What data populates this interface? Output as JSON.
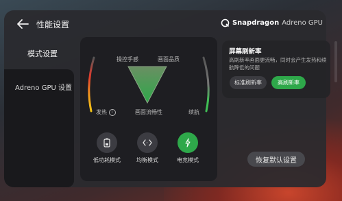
{
  "header": {
    "title": "性能设置",
    "brand_name": "Snapdragon",
    "brand_product": "Adreno GPU"
  },
  "sidebar": {
    "items": [
      {
        "label": "模式设置",
        "active": true
      },
      {
        "label": "Adreno GPU 设置",
        "active": false
      }
    ]
  },
  "performance_chart": {
    "labels": {
      "control": "操控手感",
      "quality": "画面品质",
      "heat": "发热",
      "fluency": "画面流畅性",
      "battery": "续航"
    },
    "accent_color": "#2ea84a"
  },
  "modes": [
    {
      "label": "低功耗模式",
      "icon": "battery-icon",
      "active": false
    },
    {
      "label": "均衡模式",
      "icon": "balance-icon",
      "active": false
    },
    {
      "label": "电竞模式",
      "icon": "lightning-icon",
      "active": true
    }
  ],
  "refresh": {
    "title": "屏幕刷新率",
    "description": "高刷新率画面更流畅，同时会产生发热和续航降低的问题",
    "standard_label": "标准刷新率",
    "high_label": "高刷新率",
    "selected": "high"
  },
  "restore_label": "恢复默认设置",
  "colors": {
    "accent": "#2ea84a",
    "panel": "#2a2a2e"
  }
}
